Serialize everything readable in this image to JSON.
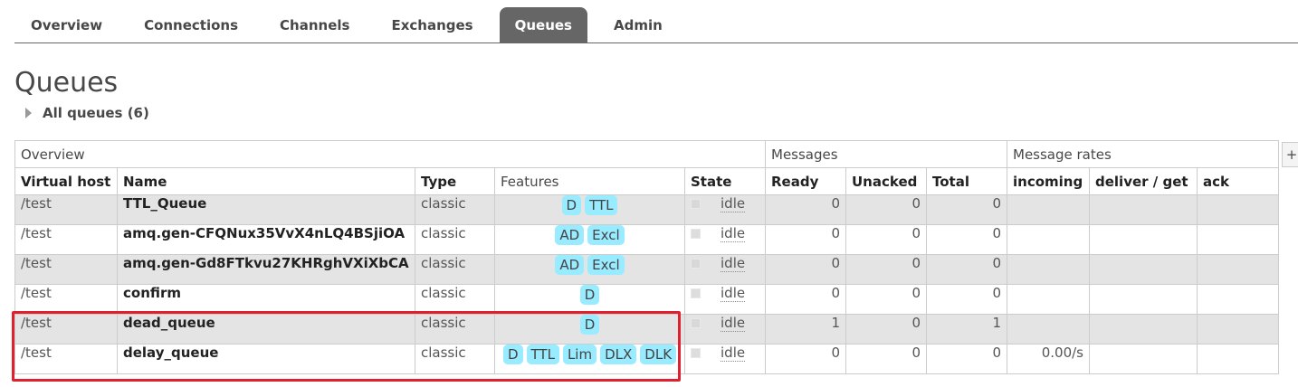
{
  "nav": {
    "tabs": [
      {
        "label": "Overview",
        "active": false
      },
      {
        "label": "Connections",
        "active": false
      },
      {
        "label": "Channels",
        "active": false
      },
      {
        "label": "Exchanges",
        "active": false
      },
      {
        "label": "Queues",
        "active": true
      },
      {
        "label": "Admin",
        "active": false
      }
    ]
  },
  "page": {
    "title": "Queues",
    "section_label": "All queues (6)"
  },
  "table": {
    "groups": {
      "overview": "Overview",
      "messages": "Messages",
      "message_rates": "Message rates"
    },
    "columns": {
      "vhost": "Virtual host",
      "name": "Name",
      "type": "Type",
      "features": "Features",
      "state": "State",
      "ready": "Ready",
      "unacked": "Unacked",
      "total": "Total",
      "incoming": "incoming",
      "deliver_get": "deliver / get",
      "ack": "ack"
    },
    "add_column_label": "+",
    "rows": [
      {
        "vhost": "/test",
        "name": "TTL_Queue",
        "type": "classic",
        "features": [
          "D",
          "TTL"
        ],
        "state": "idle",
        "ready": "0",
        "unacked": "0",
        "total": "0",
        "incoming": "",
        "deliver_get": "",
        "ack": ""
      },
      {
        "vhost": "/test",
        "name": "amq.gen-CFQNux35VvX4nLQ4BSjiOA",
        "type": "classic",
        "features": [
          "AD",
          "Excl"
        ],
        "state": "idle",
        "ready": "0",
        "unacked": "0",
        "total": "0",
        "incoming": "",
        "deliver_get": "",
        "ack": ""
      },
      {
        "vhost": "/test",
        "name": "amq.gen-Gd8FTkvu27KHRghVXiXbCA",
        "type": "classic",
        "features": [
          "AD",
          "Excl"
        ],
        "state": "idle",
        "ready": "0",
        "unacked": "0",
        "total": "0",
        "incoming": "",
        "deliver_get": "",
        "ack": ""
      },
      {
        "vhost": "/test",
        "name": "confirm",
        "type": "classic",
        "features": [
          "D"
        ],
        "state": "idle",
        "ready": "0",
        "unacked": "0",
        "total": "0",
        "incoming": "",
        "deliver_get": "",
        "ack": ""
      },
      {
        "vhost": "/test",
        "name": "dead_queue",
        "type": "classic",
        "features": [
          "D"
        ],
        "state": "idle",
        "ready": "1",
        "unacked": "0",
        "total": "1",
        "incoming": "",
        "deliver_get": "",
        "ack": ""
      },
      {
        "vhost": "/test",
        "name": "delay_queue",
        "type": "classic",
        "features": [
          "D",
          "TTL",
          "Lim",
          "DLX",
          "DLK"
        ],
        "state": "idle",
        "ready": "0",
        "unacked": "0",
        "total": "0",
        "incoming": "0.00/s",
        "deliver_get": "",
        "ack": ""
      }
    ]
  },
  "colors": {
    "badge": "#99ebff",
    "active_tab": "#666666",
    "highlight": "#e0202e"
  }
}
